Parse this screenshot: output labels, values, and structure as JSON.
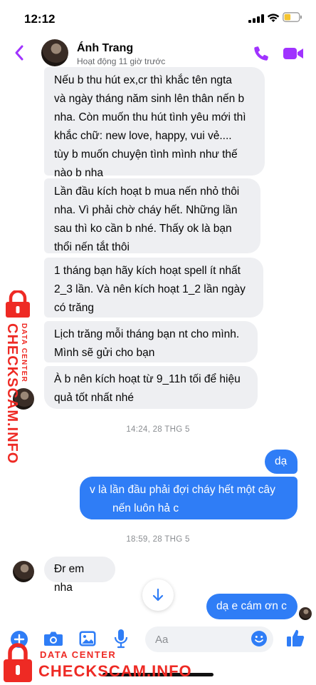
{
  "status_bar": {
    "time": "12:12"
  },
  "header": {
    "contact_name": "Ánh Trang",
    "active_status": "Hoạt động 11 giờ trước"
  },
  "messages": [
    {
      "side": "in",
      "lines": [
        "Nếu b thu hút ex,cr thì khắc tên ngta",
        "và ngày tháng năm sinh lên thân nến b",
        "nha. Còn muốn thu hút tình yêu mới thì",
        "khắc chữ: new love, happy, vui vẻ....",
        "tùy b muốn chuyện tình mình như thế",
        "nào b  nha"
      ]
    },
    {
      "side": "in",
      "lines": [
        "Lần đầu kích hoạt b mua nến nhỏ thôi",
        "nha. Vì phải chờ cháy hết. Những lần",
        "sau thì ko cần b nhé. Thấy ok là bạn",
        "thổi nến tắt thôi"
      ]
    },
    {
      "side": "in",
      "lines": [
        "1 tháng bạn hãy kích hoạt spell ít nhất",
        "2_3 lần. Và nên kích hoạt 1_2 lần ngày",
        "có trăng"
      ]
    },
    {
      "side": "in",
      "lines": [
        "Lịch trăng mỗi tháng bạn nt cho mình.",
        "Mình sẽ gửi cho bạn"
      ]
    },
    {
      "side": "in",
      "lines": [
        "À b nên kích hoạt từ 9_11h tối để hiệu",
        "quả tốt nhất nhé"
      ]
    },
    {
      "side": "timestamp",
      "text": "14:24, 28 THG 5"
    },
    {
      "side": "out",
      "lines": [
        "dạ"
      ]
    },
    {
      "side": "out",
      "lines": [
        "v là lần đầu phải đợi cháy hết một cây",
        "nến luôn hả c"
      ]
    },
    {
      "side": "timestamp",
      "text": "18:59, 28 THG 5"
    },
    {
      "side": "in",
      "lines": [
        "Đr em nha"
      ]
    },
    {
      "side": "out",
      "lines": [
        "dạ e cám ơn c"
      ]
    }
  ],
  "composer": {
    "placeholder": "Aa"
  },
  "icons": {
    "back": "chevron-left-icon",
    "call": "phone-icon",
    "video": "video-camera-icon",
    "plus": "plus-circle-icon",
    "camera": "camera-icon",
    "gallery": "image-icon",
    "mic": "microphone-icon",
    "emoji": "emoji-icon",
    "like": "thumbs-up-icon",
    "scroll_down": "arrow-down-icon"
  },
  "colors": {
    "accent": "#a033ff",
    "outgoing_bubble": "#2f7df6",
    "incoming_bubble": "#eeeff2",
    "watermark": "#ee2a24"
  },
  "watermark": {
    "small": "DATA CENTER",
    "big": "CHECKSCAM.INFO"
  }
}
